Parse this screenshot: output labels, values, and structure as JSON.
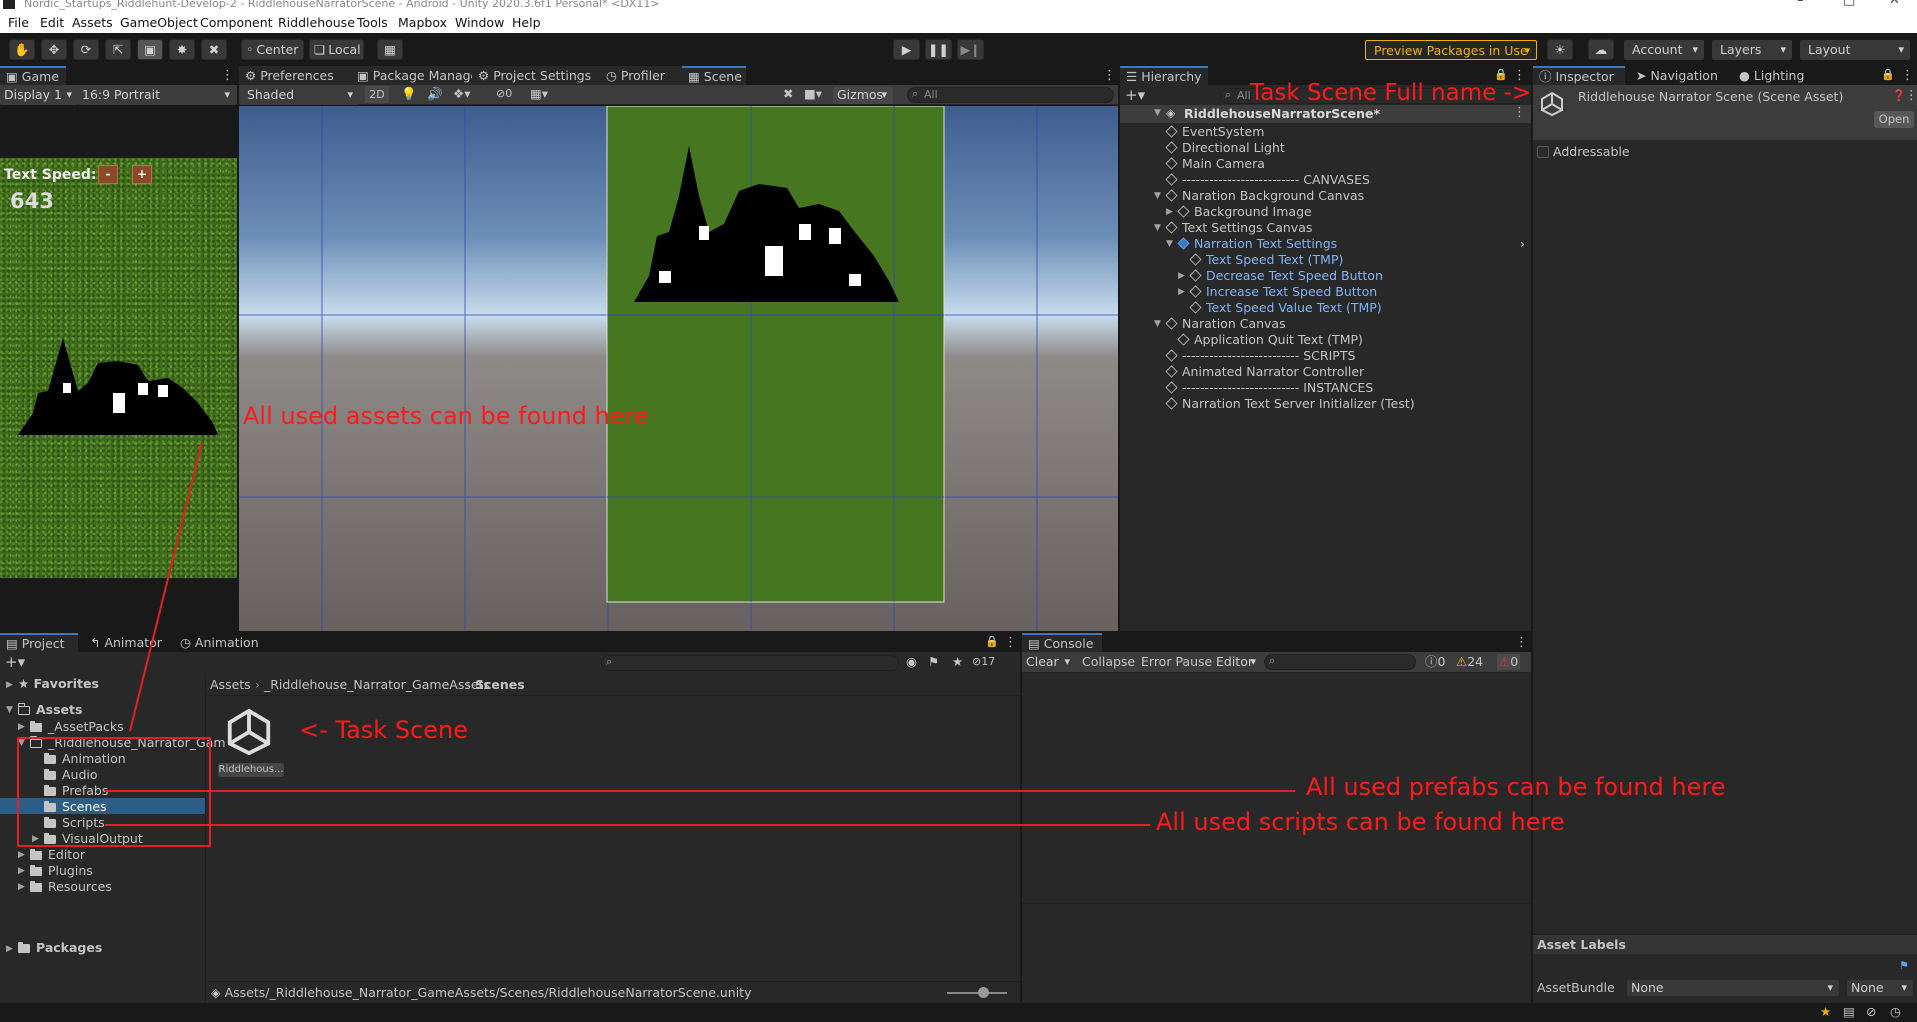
{
  "window": {
    "title": "Nordic_Startups_Riddlehunt-Develop-2 - RiddlehouseNarratorScene - Android - Unity 2020.3.6f1 Personal* <DX11>",
    "minimize": "–",
    "maximize": "□",
    "close": "✕"
  },
  "menu": [
    "File",
    "Edit",
    "Assets",
    "GameObject",
    "Component",
    "Riddlehouse",
    "Tools",
    "Mapbox",
    "Window",
    "Help"
  ],
  "toolbar": {
    "center": "Center",
    "local": "Local",
    "preview_packages": "Preview Packages in Use",
    "account": "Account",
    "layers": "Layers",
    "layout": "Layout"
  },
  "game": {
    "tab": "Game",
    "display": "Display 1",
    "aspect": "16:9 Portrait",
    "text_speed_label": "Text Speed:",
    "minus": "-",
    "plus": "+",
    "speed_value": "643"
  },
  "scene": {
    "tabs": [
      "Preferences",
      "Package Manager",
      "Project Settings",
      "Profiler",
      "Scene"
    ],
    "shading": "Shaded",
    "mode2d": "2D",
    "hidden_count": "0",
    "gizmos": "Gizmos",
    "search_placeholder": "All"
  },
  "hierarchy": {
    "tab": "Hierarchy",
    "search_placeholder": "All",
    "scene_name": "RiddlehouseNarratorScene*",
    "items": [
      {
        "label": "EventSystem",
        "depth": 1
      },
      {
        "label": "Directional Light",
        "depth": 1
      },
      {
        "label": "Main Camera",
        "depth": 1
      },
      {
        "label": "-------------------------- CANVASES",
        "depth": 1
      },
      {
        "label": "Naration Background Canvas",
        "depth": 1
      },
      {
        "label": "Background Image",
        "depth": 2
      },
      {
        "label": "Text Settings Canvas",
        "depth": 1
      },
      {
        "label": "Narration Text Settings",
        "depth": 2
      },
      {
        "label": "Text Speed Text (TMP)",
        "depth": 3
      },
      {
        "label": "Decrease Text Speed Button",
        "depth": 3
      },
      {
        "label": "Increase Text Speed Button",
        "depth": 3
      },
      {
        "label": "Text Speed Value Text (TMP)",
        "depth": 3
      },
      {
        "label": "Naration Canvas",
        "depth": 1
      },
      {
        "label": "Application Quit Text (TMP)",
        "depth": 2
      },
      {
        "label": "-------------------------- SCRIPTS",
        "depth": 1
      },
      {
        "label": "Animated Narrator Controller",
        "depth": 1
      },
      {
        "label": "-------------------------- INSTANCES",
        "depth": 1
      },
      {
        "label": "Narration Text Server Initializer (Test)",
        "depth": 1
      }
    ]
  },
  "inspector": {
    "tabs": [
      "Inspector",
      "Navigation",
      "Lighting"
    ],
    "asset_title": "Riddlehouse Narrator Scene (Scene Asset)",
    "open": "Open",
    "addressable": "Addressable",
    "asset_labels": "Asset Labels",
    "asset_bundle": "AssetBundle",
    "bundle_value": "None",
    "variant_value": "None"
  },
  "project": {
    "tabs": [
      "Project",
      "Animator",
      "Animation"
    ],
    "hidden_count": "17",
    "favorites": "Favorites",
    "assets": "Assets",
    "tree": [
      "_AssetPacks",
      "_Riddlehouse_Narrator_Gam",
      "Animation",
      "Audio",
      "Prefabs",
      "Scenes",
      "Scripts",
      "VisualOutput",
      "Editor",
      "Plugins",
      "Resources"
    ],
    "packages": "Packages",
    "breadcrumb": [
      "Assets",
      "_Riddlehouse_Narrator_GameAssets",
      "Scenes"
    ],
    "asset_name": "Riddlehous...",
    "path": "Assets/_Riddlehouse_Narrator_GameAssets/Scenes/RiddlehouseNarratorScene.unity"
  },
  "console": {
    "tab": "Console",
    "clear": "Clear",
    "collapse": "Collapse",
    "error_pause": "Error Pause",
    "editor": "Editor",
    "log_count": "0",
    "warn_count": "24",
    "err_count": "0"
  },
  "annotations": {
    "assets": "All used assets can be found here",
    "task_scene": "<- Task Scene",
    "task_scene_full": "Task Scene Full name ->",
    "prefabs": "All used prefabs can be found here",
    "scripts": "All used scripts can be found here"
  },
  "colors": {
    "accent": "#3a79bb",
    "annotation": "#ff1a1a",
    "selected_row": "#2c5d87",
    "link_blue": "#7cb4f8",
    "preview_orange": "#f0b400"
  }
}
